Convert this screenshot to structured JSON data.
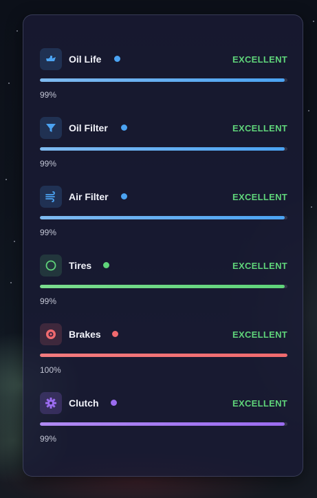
{
  "items": [
    {
      "label": "Oil Life",
      "status": "EXCELLENT",
      "percent_text": "99%",
      "level": 0.99,
      "color": "#4ba3f2",
      "icon": "oil-can-icon"
    },
    {
      "label": "Oil Filter",
      "status": "EXCELLENT",
      "percent_text": "99%",
      "level": 0.99,
      "color": "#4ba3f2",
      "icon": "funnel-icon"
    },
    {
      "label": "Air Filter",
      "status": "EXCELLENT",
      "percent_text": "99%",
      "level": 0.99,
      "color": "#4ba3f2",
      "icon": "wind-icon"
    },
    {
      "label": "Tires",
      "status": "EXCELLENT",
      "percent_text": "99%",
      "level": 0.99,
      "color": "#5fd47a",
      "icon": "circle-icon"
    },
    {
      "label": "Brakes",
      "status": "EXCELLENT",
      "percent_text": "100%",
      "level": 1.0,
      "color": "#f06a6e",
      "icon": "brake-disc-icon"
    },
    {
      "label": "Clutch",
      "status": "EXCELLENT",
      "percent_text": "99%",
      "level": 0.99,
      "color": "#9b6cf0",
      "icon": "gear-icon"
    }
  ],
  "status_color": "#5fd47a"
}
